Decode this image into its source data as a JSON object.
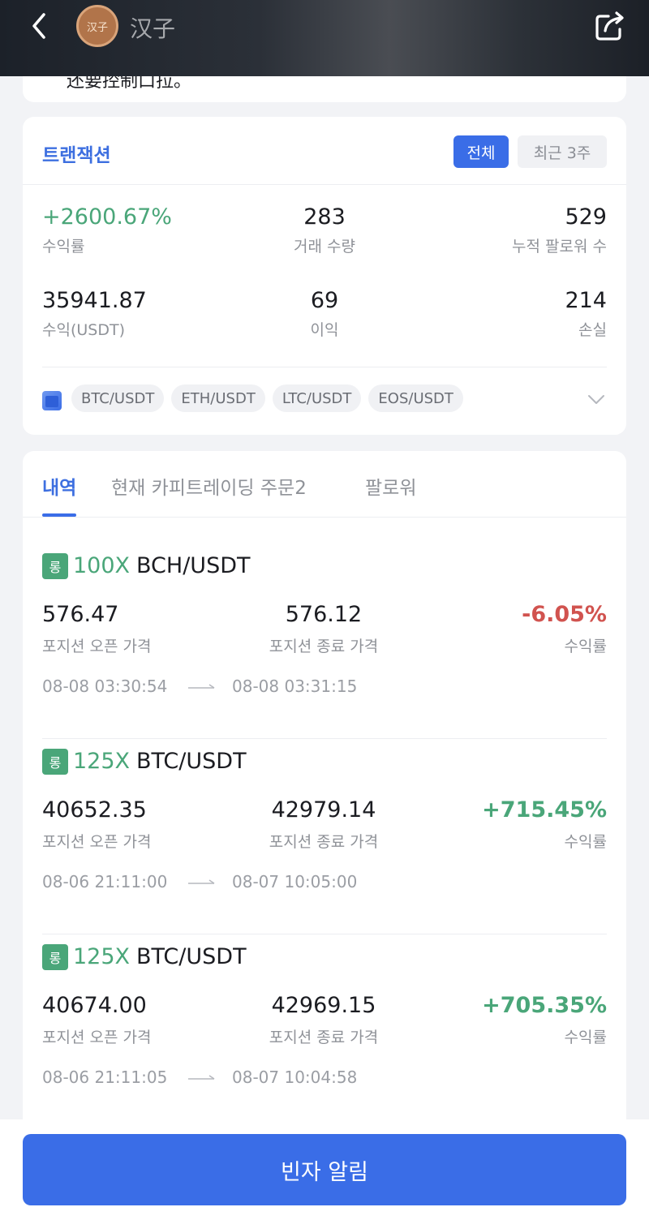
{
  "header": {
    "avatar_text": "汉子",
    "user_name": "汉子"
  },
  "top_card": {
    "cut_text": "还要控制口拉。"
  },
  "stats": {
    "title": "트랜잭션",
    "range_all": "전체",
    "range_recent": "최근 3주",
    "items": [
      {
        "value": "+2600.67%",
        "label": "수익률"
      },
      {
        "value": "283",
        "label": "거래 수량"
      },
      {
        "value": "529",
        "label": "누적 팔로워 수"
      },
      {
        "value": "35941.87",
        "label": "수익(USDT)"
      },
      {
        "value": "69",
        "label": "이익"
      },
      {
        "value": "214",
        "label": "손실"
      }
    ],
    "pairs": [
      "BTC/USDT",
      "ETH/USDT",
      "LTC/USDT",
      "EOS/USDT"
    ]
  },
  "tabs": [
    "내역",
    "현재 카피트레이딩 주문2",
    "팔로워"
  ],
  "trades": [
    {
      "side": "롱",
      "leverage": "100X",
      "symbol": "BCH/USDT",
      "open_price": "576.47",
      "open_label": "포지션 오픈 가격",
      "close_price": "576.12",
      "close_label": "포지션 종료 가격",
      "roi": "-6.05%",
      "roi_label": "수익률",
      "open_time": "08-08 03:30:54",
      "close_time": "08-08 03:31:15"
    },
    {
      "side": "롱",
      "leverage": "125X",
      "symbol": "BTC/USDT",
      "open_price": "40652.35",
      "open_label": "포지션 오픈 가격",
      "close_price": "42979.14",
      "close_label": "포지션 종료 가격",
      "roi": "+715.45%",
      "roi_label": "수익률",
      "open_time": "08-06 21:11:00",
      "close_time": "08-07 10:05:00"
    },
    {
      "side": "롱",
      "leverage": "125X",
      "symbol": "BTC/USDT",
      "open_price": "40674.00",
      "open_label": "포지션 오픈 가격",
      "close_price": "42969.15",
      "close_label": "포지션 종료 가격",
      "roi": "+705.35%",
      "roi_label": "수익률",
      "open_time": "08-06 21:11:05",
      "close_time": "08-07 10:04:58"
    }
  ],
  "bottom": {
    "notify_label": "빈자 알림"
  },
  "colors": {
    "accent": "#3a6de7",
    "profit": "#4aa679",
    "loss": "#d1534f"
  }
}
